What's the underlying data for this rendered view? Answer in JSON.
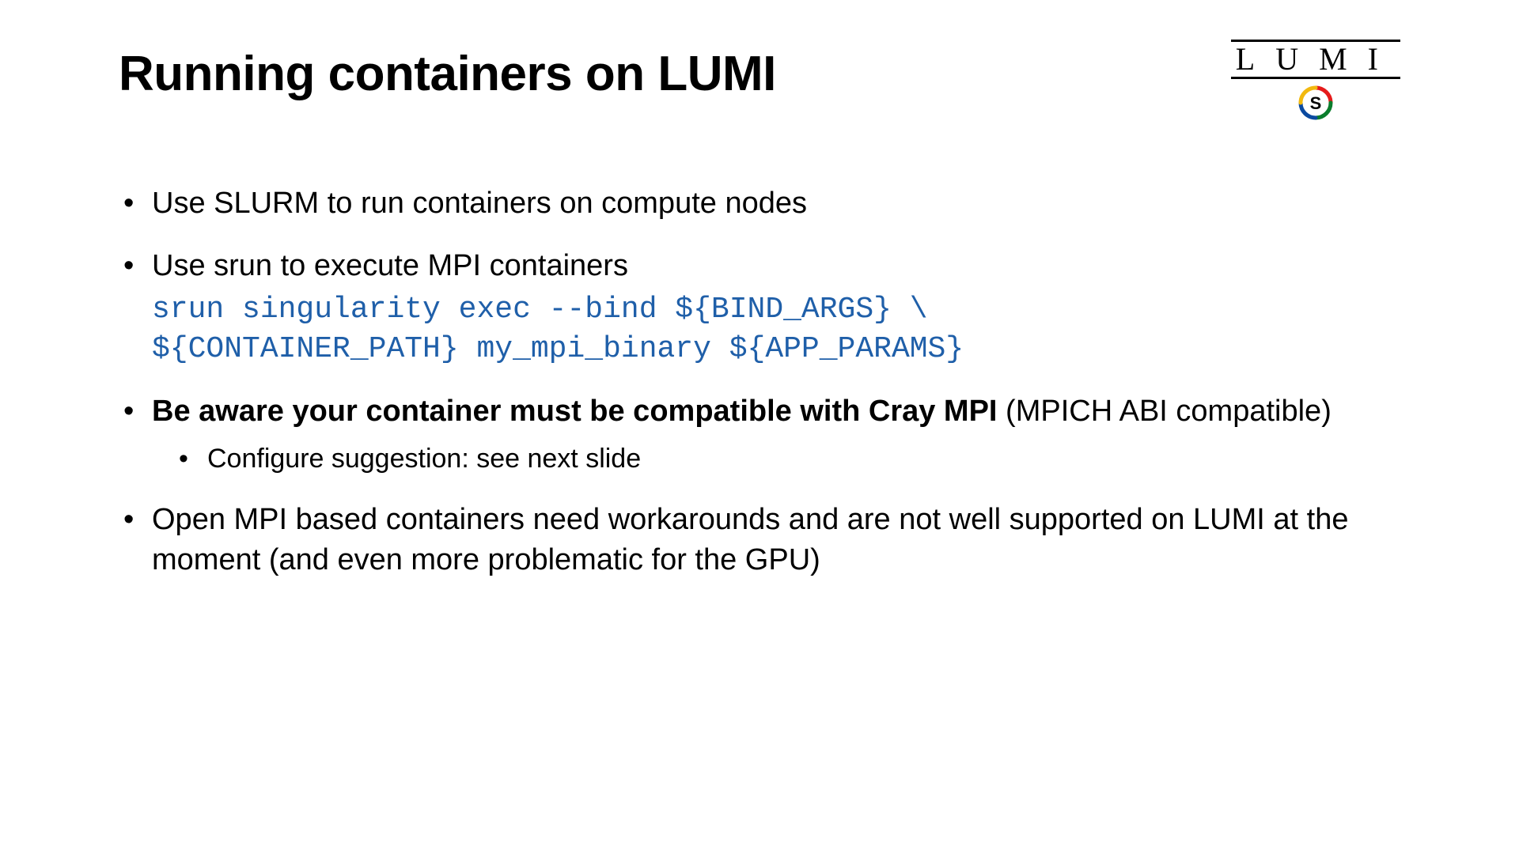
{
  "title": "Running containers on LUMI",
  "logo_text": "LUMI",
  "bullets": {
    "b1": "Use SLURM to run containers on compute nodes",
    "b2_lead": "Use srun to execute MPI containers",
    "b2_code": "srun singularity exec --bind ${BIND_ARGS} \\\n${CONTAINER_PATH} my_mpi_binary ${APP_PARAMS}",
    "b3_bold": "Be aware your container must be compatible with Cray MPI",
    "b3_rest": " (MPICH ABI compatible)",
    "b3_sub": "Configure suggestion: see next slide",
    "b4": "Open MPI based containers need workarounds and are not well supported on LUMI at the moment (and even more problematic for the GPU)"
  }
}
